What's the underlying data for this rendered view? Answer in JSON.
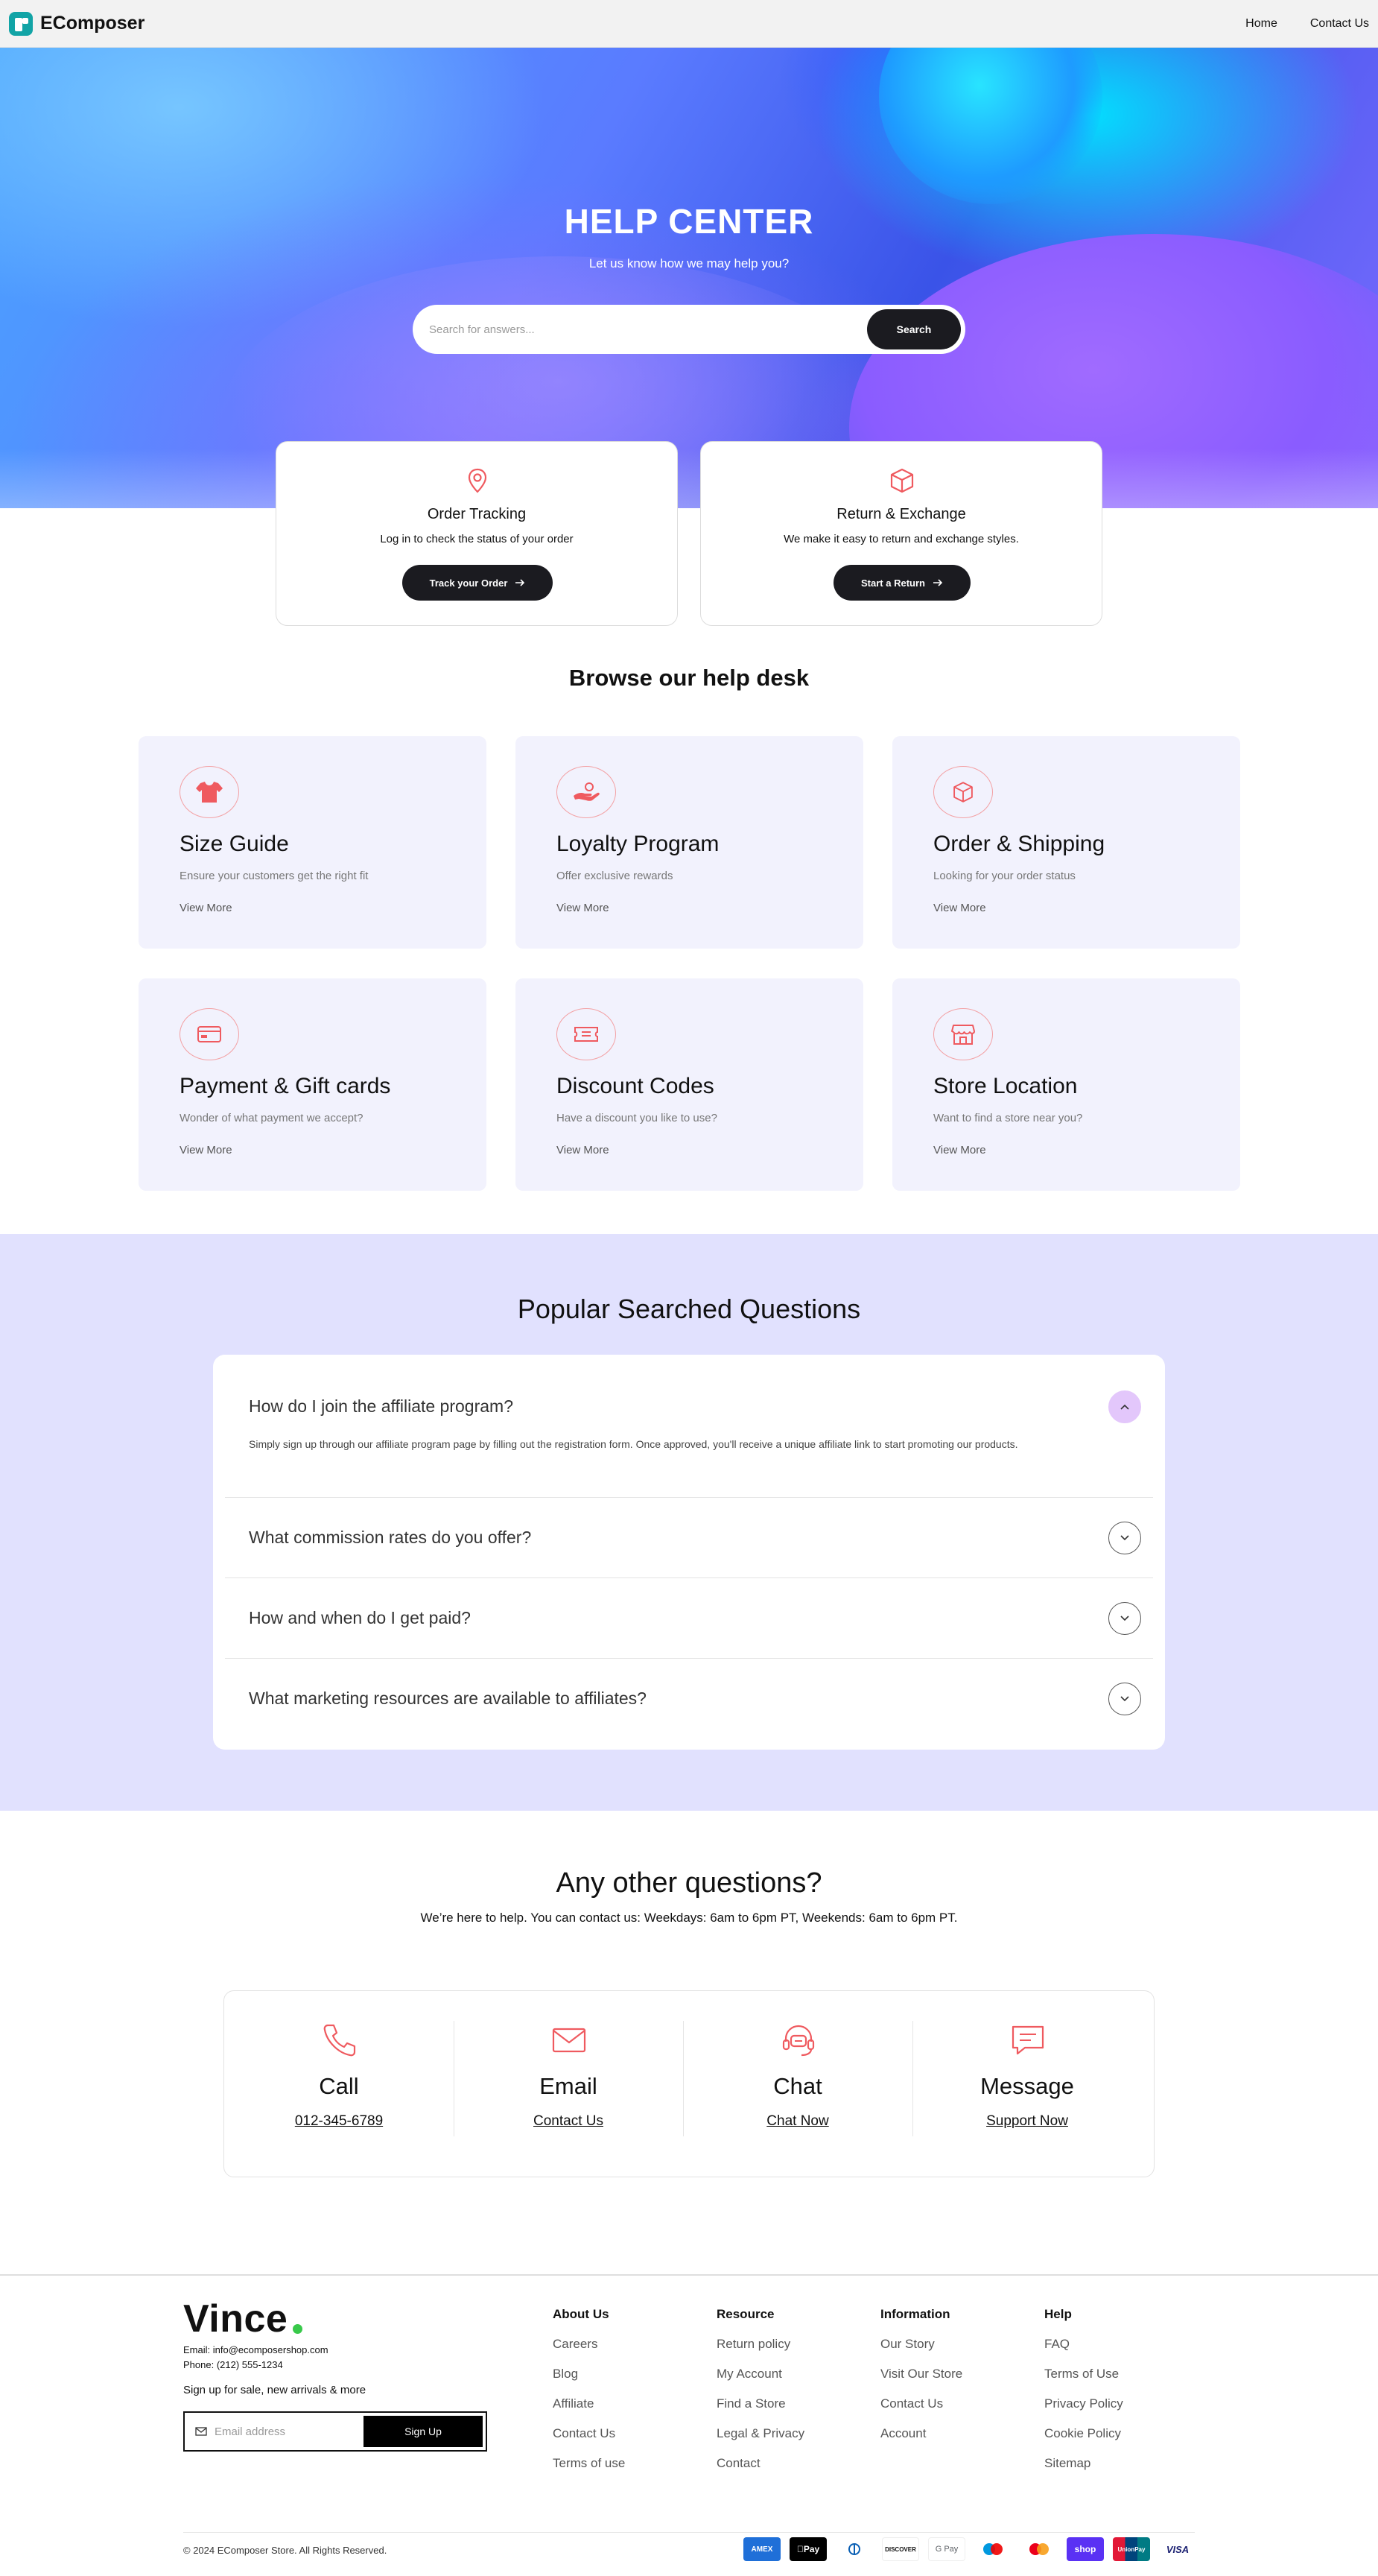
{
  "header": {
    "brand": "EComposer",
    "nav": [
      {
        "label": "Home"
      },
      {
        "label": "Contact Us"
      }
    ]
  },
  "hero": {
    "title": "HELP CENTER",
    "subtitle": "Let us know how we may help you?",
    "search_placeholder": "Search for answers...",
    "search_button": "Search"
  },
  "quick_cards": [
    {
      "icon": "location-pin-icon",
      "title": "Order Tracking",
      "description": "Log in to check the status of your order",
      "button": "Track your Order"
    },
    {
      "icon": "box-icon",
      "title": "Return & Exchange",
      "description": "We make it easy to return and exchange styles.",
      "button": "Start a Return"
    }
  ],
  "browse": {
    "title": "Browse our help desk",
    "cards": [
      {
        "icon": "tshirt-icon",
        "title": "Size Guide",
        "description": "Ensure your customers get the right fit",
        "link": "View More"
      },
      {
        "icon": "hand-coin-icon",
        "title": "Loyalty Program",
        "description": "Offer exclusive rewards",
        "link": "View More"
      },
      {
        "icon": "box-icon",
        "title": "Order & Shipping",
        "description": "Looking for your order status",
        "link": "View More"
      },
      {
        "icon": "credit-card-icon",
        "title": "Payment & Gift cards",
        "description": "Wonder of what payment we accept?",
        "link": "View More"
      },
      {
        "icon": "ticket-icon",
        "title": "Discount Codes",
        "description": "Have a discount you like to use?",
        "link": "View More"
      },
      {
        "icon": "store-icon",
        "title": "Store Location",
        "description": "Want to find a store near you?",
        "link": "View More"
      }
    ]
  },
  "faq": {
    "title": "Popular Searched Questions",
    "items": [
      {
        "question": "How do I join the affiliate program?",
        "answer": "Simply sign up through our affiliate program page by filling out the registration form. Once approved, you'll receive a unique affiliate link to start promoting our products.",
        "open": true
      },
      {
        "question": "What commission rates do you offer?",
        "answer": "",
        "open": false
      },
      {
        "question": "How and when do I get paid?",
        "answer": "",
        "open": false
      },
      {
        "question": "What marketing resources are available to affiliates?",
        "answer": "",
        "open": false
      }
    ]
  },
  "contact": {
    "title": "Any other questions?",
    "subtitle": "We’re here to help. You can contact us: Weekdays: 6am to 6pm PT, Weekends: 6am to 6pm PT.",
    "channels": [
      {
        "icon": "phone-icon",
        "title": "Call",
        "link": "012-345-6789"
      },
      {
        "icon": "envelope-icon",
        "title": "Email",
        "link": "Contact Us"
      },
      {
        "icon": "headset-icon",
        "title": "Chat",
        "link": "Chat Now"
      },
      {
        "icon": "message-icon",
        "title": "Message",
        "link": "Support Now"
      }
    ]
  },
  "footer": {
    "brand": "Vince",
    "email": "Email: info@ecomposershop.com",
    "phone": "Phone: (212) 555-1234",
    "signup_label": "Sign up for sale, new arrivals & more",
    "signup_placeholder": "Email address",
    "signup_button": "Sign Up",
    "columns": [
      {
        "heading": "About Us",
        "links": [
          "Careers",
          "Blog",
          "Affiliate",
          "Contact Us",
          "Terms of use"
        ]
      },
      {
        "heading": "Resource",
        "links": [
          "Return policy",
          "My Account",
          "Find a Store",
          "Legal & Privacy",
          "Contact"
        ]
      },
      {
        "heading": "Information",
        "links": [
          "Our Story",
          "Visit Our Store",
          "Contact Us",
          "Account"
        ]
      },
      {
        "heading": "Help",
        "links": [
          "FAQ",
          "Terms of Use",
          "Privacy Policy",
          "Cookie Policy",
          "Sitemap"
        ]
      }
    ],
    "copyright": "© 2024 EComposer Store. All Rights Reserved.",
    "payments": [
      {
        "name": "American Express",
        "label": "AMEX"
      },
      {
        "name": "Apple Pay",
        "label": "Pay"
      },
      {
        "name": "Diners Club",
        "label": "D"
      },
      {
        "name": "Discover",
        "label": "DISCOVER"
      },
      {
        "name": "Google Pay",
        "label": "G Pay"
      },
      {
        "name": "Maestro",
        "label": ""
      },
      {
        "name": "Mastercard",
        "label": ""
      },
      {
        "name": "Shop Pay",
        "label": "shop"
      },
      {
        "name": "UnionPay",
        "label": "UnionPay"
      },
      {
        "name": "Visa",
        "label": "VISA"
      }
    ]
  },
  "colors": {
    "accent": "#ef5a5f",
    "dark_button": "#1b1b20",
    "card_bg": "#f2f2fd",
    "faq_bg": "#e1e1fe",
    "faq_open_toggle": "#e3c7fb",
    "brand_dot": "#38c94a"
  }
}
